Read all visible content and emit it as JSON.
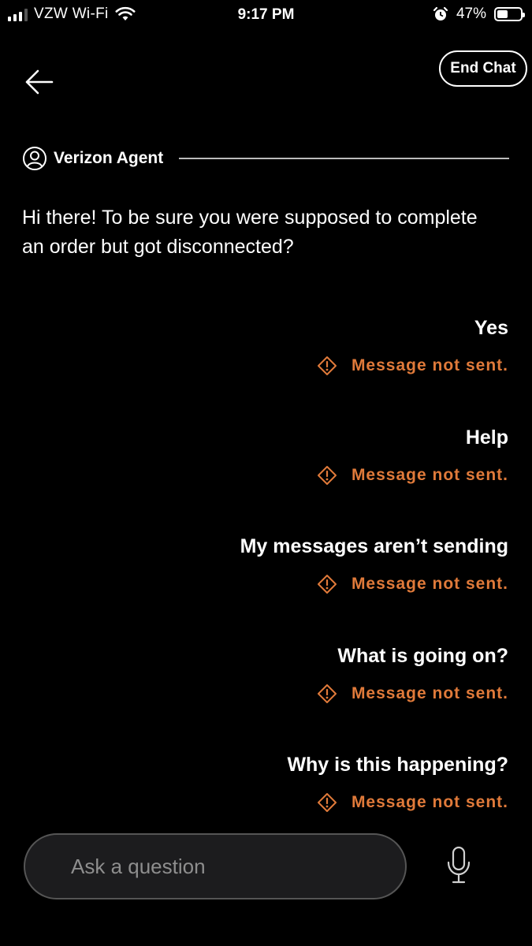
{
  "status_bar": {
    "carrier": "VZW Wi-Fi",
    "time": "9:17 PM",
    "battery_percent": "47%",
    "battery_level": 0.47,
    "icons": [
      "signal-icon",
      "wifi-icon",
      "alarm-icon",
      "battery-icon"
    ]
  },
  "header": {
    "back_icon": "back-arrow-icon",
    "end_chat_label": "End Chat"
  },
  "agent": {
    "name": "Verizon Agent",
    "icon": "user-circle-icon",
    "message": "Hi there! To be sure you were supposed to complete an order but got disconnected?"
  },
  "messages": [
    {
      "text": "Yes",
      "status": "Message not sent."
    },
    {
      "text": "Help",
      "status": "Message not sent."
    },
    {
      "text": "My messages aren’t sending",
      "status": "Message not sent."
    },
    {
      "text": "What is going on?",
      "status": "Message not sent."
    },
    {
      "text": "Why is this happening?",
      "status": "Message not sent."
    }
  ],
  "composer": {
    "placeholder": "Ask a question",
    "mic_icon": "microphone-icon"
  },
  "colors": {
    "background": "#000000",
    "error": "#e07a3a",
    "input_bg": "#1c1c1e"
  }
}
